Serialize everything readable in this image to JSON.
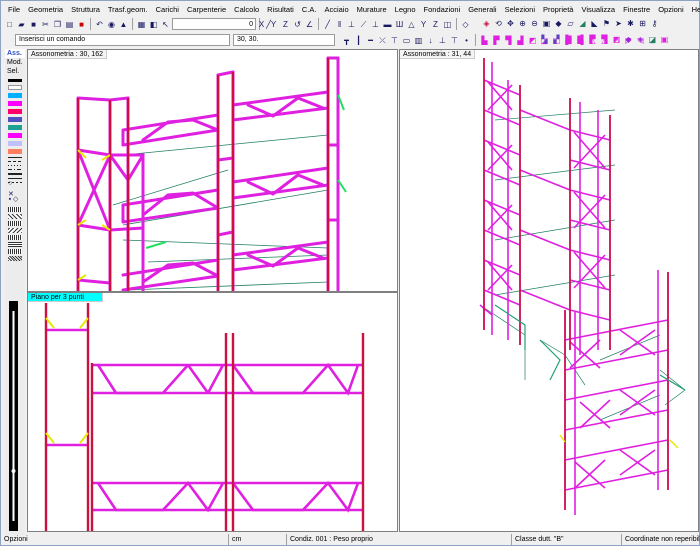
{
  "menu": [
    "File",
    "Geometria",
    "Struttura",
    "Trasf.geom.",
    "Carichi",
    "Carpenterie",
    "Calcolo",
    "Risultati",
    "C.A.",
    "Acciaio",
    "Murature",
    "Legno",
    "Fondazioni",
    "Generali",
    "Selezioni",
    "Proprietà",
    "Visualizza",
    "Finestre",
    "Opzioni",
    "Help"
  ],
  "toolbar": {
    "zoom_value": "0",
    "command_placeholder": "Inserisci un comando",
    "coord_value": "30, 30."
  },
  "palette": {
    "tabs": [
      "Ass.",
      "Mod.",
      "Sel."
    ],
    "colors": [
      "#ffffff",
      "#00b0ff",
      "#ff00ff",
      "#ff0066",
      "#5050c0",
      "#20a090",
      "#ff00ff",
      "#c0c0ff",
      "#ff8060"
    ]
  },
  "views": {
    "top_left": {
      "title": "Assonometria :  30, 162"
    },
    "bottom_left": {
      "title": "Piano per 3 punti"
    },
    "right": {
      "title": "Assonometria :  31, 44"
    }
  },
  "colors": {
    "brace": "#e020e0",
    "column": "#cc1040",
    "accent_yellow": "#e8e800",
    "line_green": "#208060"
  },
  "status": {
    "left": "Opzioni",
    "units": "cm",
    "condition": "Condiz. 001 : Peso proprio",
    "class": "Classe dutt. \"B\"",
    "coords": "Coordinate non reperibili"
  }
}
